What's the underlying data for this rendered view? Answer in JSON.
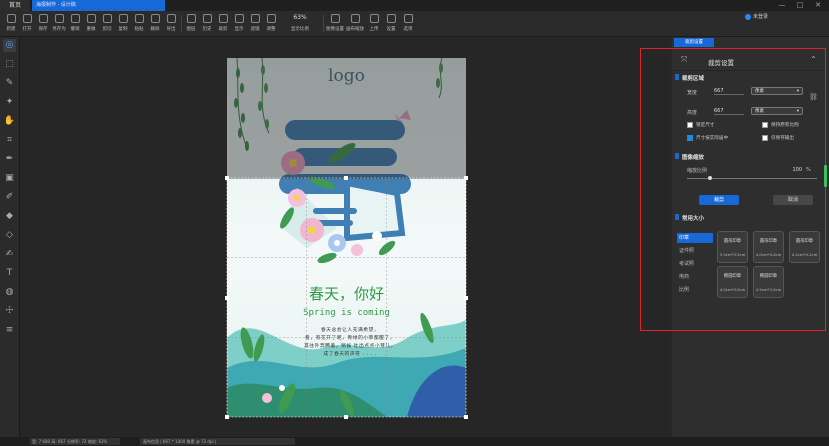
{
  "titlebar": {
    "home_tab": "首页",
    "doc_tab": "海报制作 · 设计稿",
    "minimize": "—",
    "maximize": "□",
    "close": "✕"
  },
  "toolbar": {
    "items": [
      "新建",
      "打开",
      "保存",
      "另存为",
      "撤销",
      "重做",
      "剪切",
      "复制",
      "粘贴",
      "删除",
      "导出",
      "图层",
      "历史",
      "裁剪",
      "显示",
      "滤镜",
      "调整"
    ],
    "zoom_value": "63%",
    "zoom_label": "显示比例",
    "items_right": [
      "图像设置",
      "画布缩放",
      "上传",
      "设置",
      "选项"
    ],
    "user": "未登录"
  },
  "poster": {
    "logo": "logo",
    "big_char": "春",
    "title": "春天，你好",
    "subtitle": "Spring is coming",
    "poem": [
      "春天总会让人充满希望，",
      "看，有花开了呢，青绿的小草都醒了，",
      "其往外奔腾着，稍候     吐出点点小芽儿，",
      "成了春天的声符 . . . ."
    ]
  },
  "panel": {
    "top_tab": "裁剪设置",
    "header": "裁剪设置",
    "crop_section": "裁剪区域",
    "width_label": "宽度",
    "width_value": "667",
    "height_label": "高度",
    "height_value": "667",
    "unit": "像素",
    "checkboxes": [
      {
        "label": "锁定尺寸",
        "checked": false
      },
      {
        "label": "保持原有比例",
        "checked": false
      },
      {
        "label": "尺寸按实际居中",
        "checked": true
      },
      {
        "label": "仅保存输出",
        "checked": false
      }
    ],
    "scale_section": "图像缩放",
    "scale_label": "缩放比例",
    "scale_value": "100",
    "scale_unit": "%",
    "scale_fraction": 0.18,
    "apply": "裁剪",
    "cancel": "取消",
    "size_section": "常用大小",
    "categories": [
      "印章",
      "证件照",
      "考试照",
      "电商",
      "比例"
    ],
    "active_category": 0,
    "cards": [
      {
        "name": "圆形印章",
        "size": "3.5cm*3.5cm"
      },
      {
        "name": "圆形印章",
        "size": "4.0cm*4.0cm"
      },
      {
        "name": "圆形印章",
        "size": "4.2cm*4.2cm"
      },
      {
        "name": "椭圆印章",
        "size": "4.0cm*3.0cm"
      },
      {
        "name": "椭圆印章",
        "size": "4.5cm*3.0cm"
      }
    ]
  },
  "status": {
    "left": "宽: 7 680  高: 667  分辨率: 72  缩放: 63%",
    "middle": "画布信息 | 667 * 1000 像素 @ 72 dpi |"
  }
}
